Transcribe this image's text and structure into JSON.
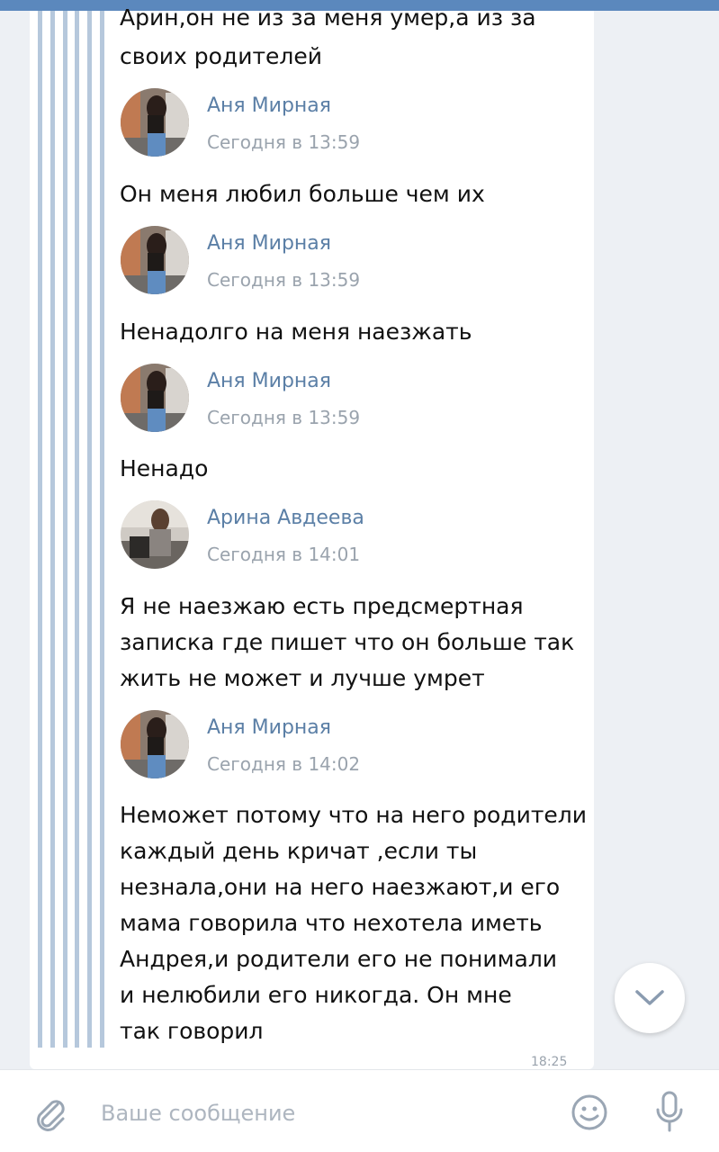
{
  "colors": {
    "accent": "#5b88bd",
    "author_name": "#5b7fa6",
    "quote_bar": "#b6c8dc",
    "icon_gray": "#9aa6b4"
  },
  "messages": [
    {
      "lines": [
        "Арин,он не из за меня умер,а из за",
        "своих родителей"
      ]
    },
    {
      "author": "Аня Мирная",
      "time": "Сегодня в 13:59",
      "lines": [
        "Он меня любил больше чем их"
      ]
    },
    {
      "author": "Аня Мирная",
      "time": "Сегодня в 13:59",
      "lines": [
        "Ненадолго на меня наезжать"
      ]
    },
    {
      "author": "Аня Мирная",
      "time": "Сегодня в 13:59",
      "lines": [
        "Ненадо"
      ]
    },
    {
      "author": "Арина Авдеева",
      "time": "Сегодня в 14:01",
      "lines": [
        "Я не наезжаю есть предсмертная",
        "записка где пишет что он больше так",
        "жить не может и лучше умрет"
      ]
    },
    {
      "author": "Аня Мирная",
      "time": "Сегодня в 14:02",
      "lines": [
        "Неможет потому что на него родители",
        "каждый день кричат ,если ты",
        "незнала,они на него наезжают,и его",
        "мама говорила что нехотела иметь",
        "Андрея,и родители его не понимали",
        "и нелюбили его никогда. Он мне",
        "так говорил"
      ]
    }
  ],
  "message_time": "18:25",
  "composer": {
    "placeholder": "Ваше сообщение",
    "attach_icon": "paperclip-icon",
    "emoji_icon": "smiley-icon",
    "voice_icon": "microphone-icon"
  },
  "scroll_button_icon": "chevron-down-icon"
}
